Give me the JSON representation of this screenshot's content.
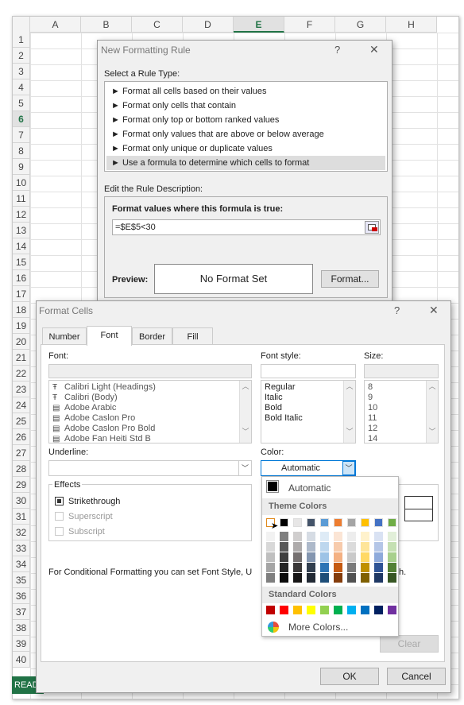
{
  "sheet": {
    "columns": [
      "A",
      "B",
      "C",
      "D",
      "E",
      "F",
      "G",
      "H"
    ],
    "rows": [
      "1",
      "2",
      "3",
      "4",
      "5",
      "6",
      "7",
      "8",
      "9",
      "10",
      "11",
      "12",
      "13",
      "14",
      "15",
      "16",
      "17",
      "18",
      "19",
      "20",
      "21",
      "22",
      "23",
      "24",
      "25",
      "26",
      "27",
      "28",
      "29",
      "30",
      "31",
      "32",
      "33",
      "34",
      "35",
      "36",
      "37",
      "38",
      "39",
      "40"
    ],
    "selected_column": "E",
    "selected_row": "6",
    "status": "READ"
  },
  "rule_dialog": {
    "title": "New Formatting Rule",
    "help": "?",
    "close": "✕",
    "select_label": "Select a Rule Type:",
    "rule_types": [
      "► Format all cells based on their values",
      "► Format only cells that contain",
      "► Format only top or bottom ranked values",
      "► Format only values that are above or below average",
      "► Format only unique or duplicate values",
      "► Use a formula to determine which cells to format"
    ],
    "edit_label": "Edit the Rule Description:",
    "formula_label": "Format values where this formula is true:",
    "formula_value": "=$E$5<30",
    "preview_label": "Preview:",
    "preview_text": "No Format Set",
    "format_button": "Format..."
  },
  "format_dialog": {
    "title": "Format Cells",
    "help": "?",
    "close": "✕",
    "tabs": [
      "Number",
      "Font",
      "Border",
      "Fill"
    ],
    "font_label": "Font:",
    "fonts": [
      "Calibri Light (Headings)",
      "Calibri (Body)",
      "Adobe Arabic",
      "Adobe Caslon Pro",
      "Adobe Caslon Pro Bold",
      "Adobe Fan Heiti Std B"
    ],
    "style_label": "Font style:",
    "styles": [
      "Regular",
      "Italic",
      "Bold",
      "Bold Italic"
    ],
    "size_label": "Size:",
    "sizes": [
      "8",
      "9",
      "10",
      "11",
      "12",
      "14"
    ],
    "underline_label": "Underline:",
    "color_label": "Color:",
    "color_value": "Automatic",
    "effects_label": "Effects",
    "strikethrough": "Strikethrough",
    "superscript": "Superscript",
    "subscript": "Subscript",
    "note": "For Conditional Formatting you can set Font Style, U",
    "note_end": "h.",
    "clear_button": "Clear",
    "ok_button": "OK",
    "cancel_button": "Cancel"
  },
  "color_popup": {
    "automatic": "Automatic",
    "theme_label": "Theme Colors",
    "standard_label": "Standard Colors",
    "more": "More Colors...",
    "theme_top": [
      "#ffffff",
      "#000000",
      "#e7e6e6",
      "#44546a",
      "#5b9bd5",
      "#ed7d31",
      "#a5a5a5",
      "#ffc000",
      "#4472c4",
      "#70ad47"
    ],
    "theme_shades": [
      [
        "#f2f2f2",
        "#7f7f7f",
        "#d0cece",
        "#d6dce4",
        "#deebf6",
        "#fbe5d5",
        "#ededed",
        "#fff2cc",
        "#d9e2f3",
        "#e2efd9"
      ],
      [
        "#d8d8d8",
        "#595959",
        "#aeabab",
        "#adb9ca",
        "#bdd7ee",
        "#f7cbac",
        "#dbdbdb",
        "#fee599",
        "#b4c6e7",
        "#c5e0b3"
      ],
      [
        "#bfbfbf",
        "#3f3f3f",
        "#757070",
        "#8496b0",
        "#9dc3e6",
        "#f4b183",
        "#c9c9c9",
        "#ffd965",
        "#8eaadb",
        "#a8d08d"
      ],
      [
        "#a5a5a5",
        "#262626",
        "#3a3838",
        "#323f4f",
        "#2e75b5",
        "#c55a11",
        "#7b7b7b",
        "#bf9000",
        "#2f5496",
        "#538135"
      ],
      [
        "#7f7f7f",
        "#0c0c0c",
        "#171616",
        "#222a35",
        "#1e4e79",
        "#843c0b",
        "#525252",
        "#7f6000",
        "#1f3864",
        "#375623"
      ]
    ],
    "standard": [
      "#c00000",
      "#ff0000",
      "#ffc000",
      "#ffff00",
      "#92d050",
      "#00b050",
      "#00b0f0",
      "#0070c0",
      "#002060",
      "#7030a0"
    ]
  }
}
